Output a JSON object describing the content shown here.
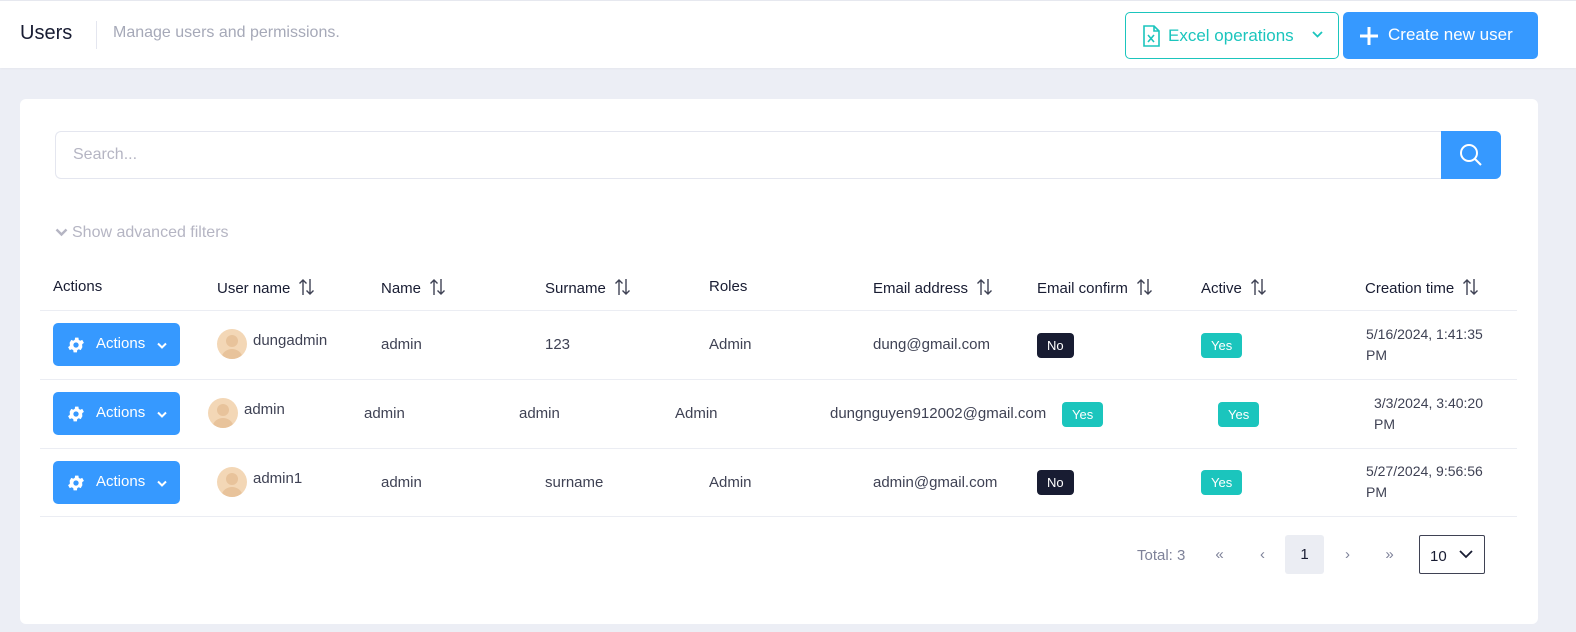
{
  "header": {
    "title": "Users",
    "subtitle": "Manage users and permissions.",
    "excel_button": "Excel operations",
    "create_button": "Create new user"
  },
  "search": {
    "placeholder": "Search..."
  },
  "filters": {
    "toggle_label": "Show advanced filters"
  },
  "table": {
    "columns": [
      "Actions",
      "User name",
      "Name",
      "Surname",
      "Roles",
      "Email address",
      "Email confirm",
      "Active",
      "Creation time"
    ],
    "rows": [
      {
        "action_label": "Actions",
        "username": "dungadmin",
        "name": "admin",
        "surname": "123",
        "roles": "Admin",
        "email": "dung@gmail.com",
        "email_confirm": "No",
        "active": "Yes",
        "creation_time": "5/16/2024, 1:41:35 PM"
      },
      {
        "action_label": "Actions",
        "username": "admin",
        "name": "admin",
        "surname": "admin",
        "roles": "Admin",
        "email": "dungnguyen912002@gmail.com",
        "email_confirm": "Yes",
        "active": "Yes",
        "creation_time": "3/3/2024, 3:40:20 PM"
      },
      {
        "action_label": "Actions",
        "username": "admin1",
        "name": "admin",
        "surname": "surname",
        "roles": "Admin",
        "email": "admin@gmail.com",
        "email_confirm": "No",
        "active": "Yes",
        "creation_time": "5/27/2024, 9:56:56 PM"
      }
    ]
  },
  "pagination": {
    "total_label": "Total: 3",
    "first": "«",
    "prev": "‹",
    "current_page": "1",
    "next": "›",
    "last": "»",
    "page_size": "10"
  },
  "colors": {
    "primary": "#3699ff",
    "success": "#1bc5bd",
    "dark": "#181c32",
    "muted": "#b5b5c3"
  },
  "icons": {
    "excel": "excel-file-icon",
    "create": "plus-icon",
    "search": "search-icon",
    "filter_toggle": "chevron-down-icon",
    "sort": "sort-arrows-icon",
    "action": "gear-icon",
    "avatar": "user-avatar-icon"
  }
}
